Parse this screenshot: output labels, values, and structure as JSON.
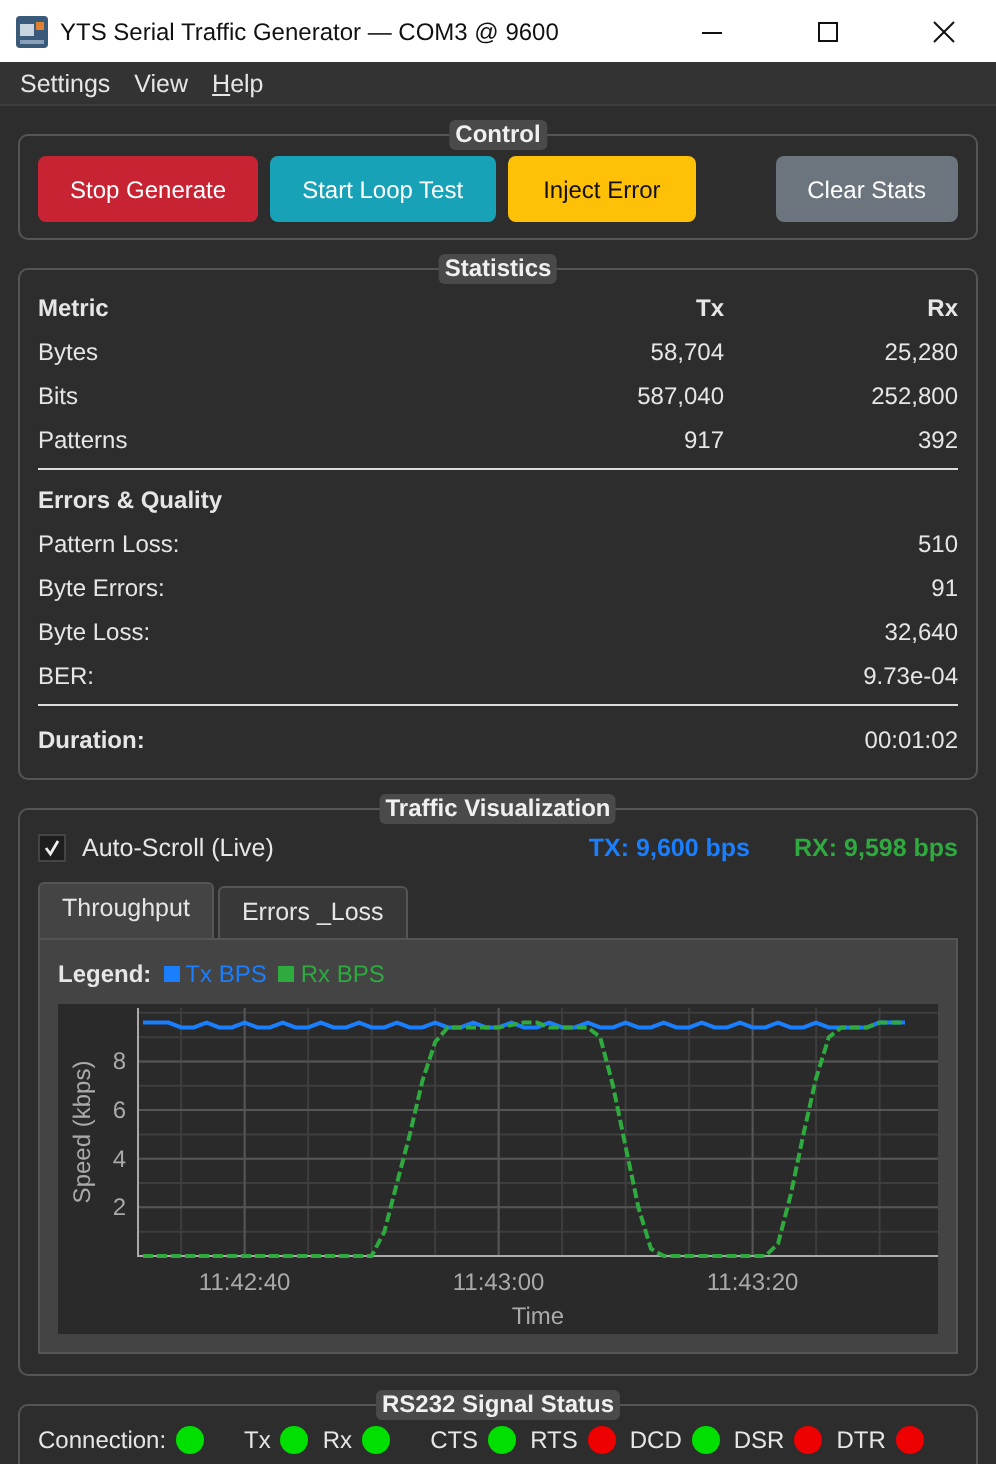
{
  "window": {
    "title": "YTS Serial Traffic Generator — COM3 @ 9600"
  },
  "menu": [
    {
      "label": "Settings",
      "mnemonic_shown": false
    },
    {
      "label": "View",
      "mnemonic_shown": false
    },
    {
      "label": "Help",
      "mnemonic_shown": true
    }
  ],
  "control": {
    "title": "Control",
    "buttons": [
      {
        "label": "Stop Generate",
        "kind": "danger"
      },
      {
        "label": "Start Loop Test",
        "kind": "info"
      },
      {
        "label": "Inject Error",
        "kind": "warning"
      },
      {
        "label": "Clear Stats",
        "kind": "secondary"
      }
    ]
  },
  "statistics": {
    "title": "Statistics",
    "columns": [
      "Metric",
      "Tx",
      "Rx"
    ],
    "rows": [
      [
        "Bytes",
        "58,704",
        "25,280"
      ],
      [
        "Bits",
        "587,040",
        "252,800"
      ],
      [
        "Patterns",
        "917",
        "392"
      ]
    ],
    "errors_heading": "Errors & Quality",
    "errors": [
      {
        "label": "Pattern Loss:",
        "value": "510"
      },
      {
        "label": "Byte Errors:",
        "value": "91"
      },
      {
        "label": "Byte Loss:",
        "value": "32,640"
      },
      {
        "label": "BER:",
        "value": "9.73e-04"
      }
    ],
    "duration": {
      "label": "Duration:",
      "value": "00:01:02"
    }
  },
  "traffic": {
    "title": "Traffic Visualization",
    "auto_scroll": {
      "label": "Auto-Scroll (Live)",
      "checked": true
    },
    "tx_rate": "TX: 9,600 bps",
    "rx_rate": "RX: 9,598 bps",
    "tabs": [
      {
        "label": "Throughput",
        "selected": true
      },
      {
        "label": "Errors _Loss",
        "selected": false
      }
    ],
    "legend_label": "Legend:",
    "chart_data": {
      "type": "line",
      "xlabel": "Time",
      "ylabel": "Speed (kbps)",
      "categories": [
        null,
        null,
        null,
        null,
        null,
        null,
        null,
        null,
        "11:42:40",
        null,
        null,
        null,
        null,
        null,
        null,
        null,
        null,
        null,
        null,
        null,
        null,
        null,
        null,
        null,
        null,
        null,
        null,
        null,
        "11:43:00",
        null,
        null,
        null,
        null,
        null,
        null,
        null,
        null,
        null,
        null,
        null,
        null,
        null,
        null,
        null,
        null,
        null,
        null,
        null,
        "11:43:20",
        null,
        null,
        null,
        null,
        null,
        null,
        null,
        null,
        null,
        null,
        null,
        null
      ],
      "grid": true,
      "series": [
        {
          "name": "Tx BPS",
          "color": "#1a7fff",
          "line_style": "solid",
          "values": [
            9.6,
            9.6,
            9.6,
            9.4,
            9.4,
            9.6,
            9.4,
            9.4,
            9.6,
            9.4,
            9.4,
            9.6,
            9.4,
            9.4,
            9.6,
            9.4,
            9.4,
            9.6,
            9.4,
            9.4,
            9.6,
            9.4,
            9.4,
            9.6,
            9.4,
            9.4,
            9.6,
            9.4,
            9.4,
            9.6,
            9.4,
            9.4,
            9.6,
            9.4,
            9.4,
            9.6,
            9.4,
            9.4,
            9.6,
            9.4,
            9.4,
            9.6,
            9.4,
            9.4,
            9.6,
            9.4,
            9.4,
            9.6,
            9.4,
            9.4,
            9.6,
            9.4,
            9.4,
            9.6,
            9.4,
            9.4,
            9.4,
            9.4,
            9.6,
            9.6,
            9.6
          ]
        },
        {
          "name": "Rx BPS",
          "color": "#2eaa3f",
          "line_style": "dashed",
          "values": [
            0,
            0,
            0,
            0,
            0,
            0,
            0,
            0,
            0,
            0,
            0,
            0,
            0,
            0,
            0,
            0,
            0,
            0,
            0,
            1.0,
            3.0,
            5.0,
            7.2,
            8.8,
            9.4,
            9.4,
            9.4,
            9.4,
            9.4,
            9.5,
            9.6,
            9.6,
            9.4,
            9.4,
            9.4,
            9.4,
            9.0,
            7.0,
            4.5,
            2.0,
            0.3,
            0,
            0,
            0,
            0,
            0,
            0,
            0,
            0,
            0,
            0.5,
            2.5,
            5.0,
            7.3,
            9.0,
            9.4,
            9.4,
            9.4,
            9.6,
            9.6,
            9.6
          ]
        }
      ],
      "ylim": [
        0,
        10.2
      ],
      "yticks": [
        2,
        4,
        6,
        8
      ]
    }
  },
  "signals": {
    "title": "RS232 Signal Status",
    "items": [
      {
        "label": "Connection:",
        "on": true
      },
      {
        "label": "Tx",
        "on": true
      },
      {
        "label": "Rx",
        "on": true
      },
      {
        "label": "CTS",
        "on": true
      },
      {
        "label": "RTS",
        "on": false
      },
      {
        "label": "DCD",
        "on": true
      },
      {
        "label": "DSR",
        "on": false
      },
      {
        "label": "DTR",
        "on": false
      }
    ]
  }
}
